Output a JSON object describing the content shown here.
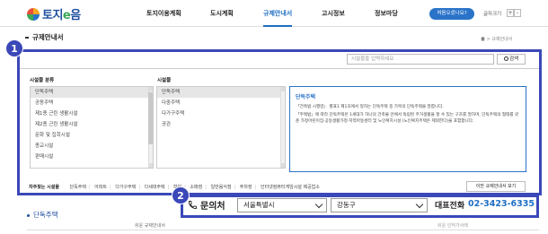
{
  "header": {
    "logo_text_1": "토지",
    "logo_text_2": "e",
    "logo_text_3": "음",
    "nav": [
      "토지이용계획",
      "도시계획",
      "규제안내서",
      "고시정보",
      "정보마당"
    ],
    "active_nav": "규제안내서",
    "first_visit": "처음오셨나요?",
    "font_size_label": "글자크기",
    "font_plus": "+",
    "font_minus": "-"
  },
  "page": {
    "title": "규제안내서",
    "breadcrumb": "> 규제안내서"
  },
  "badges": {
    "one": "1",
    "two": "2"
  },
  "search": {
    "placeholder": "시설물을 입력하세요",
    "button": "검색"
  },
  "category": {
    "label": "시설물 분류",
    "items": [
      "단독주택",
      "공동주택",
      "제1종 근린 생활시설",
      "제2종 근린 생활시설",
      "문화 및 집회시설",
      "종교시설",
      "판매시설"
    ],
    "selected_index": 0
  },
  "facility": {
    "label": "시설물",
    "items": [
      "단독주택",
      "다중주택",
      "다가구주택",
      "공관"
    ],
    "selected_index": 0
  },
  "description": {
    "title": "단독주택",
    "paragraphs": [
      "「건축법 시행령」 별표1 제1호에서 정하는 단독주택 중 가목의 단독주택을 말합니다.",
      "「주택법」에 따라 단독주택은 1세대가 하나의 건축물 안에서 독립된 주거생활을 할 수 있는 구조를 말하며, 단독주택의 형태를 갖춘 가정어린이집·공동생활가정·지역아동센터 및 노인복지시설 (노인복지주택은 제외한다)을 포함합니다."
    ]
  },
  "frequent": {
    "label": "자주찾는 시설물",
    "items": [
      "단독주택",
      "아파트",
      "다가구주택",
      "다세대주택",
      "학원",
      "소매점",
      "일반음식점",
      "주차장",
      "인터넷컴퓨터게임시설 제공업소"
    ],
    "prev_button": "이전 규제안내서 보기"
  },
  "section": {
    "title": "단독주택",
    "tab_left": "쉬운 규제안내서",
    "tab_right": "쉬운 인허가사례"
  },
  "contact": {
    "label": "문의처",
    "city": "서울특별시",
    "district": "강동구",
    "tel_label": "대표전화",
    "tel": "02-3423-6335"
  },
  "colors": {
    "accent": "#1f6fc5",
    "highlight": "#3b48b8"
  }
}
